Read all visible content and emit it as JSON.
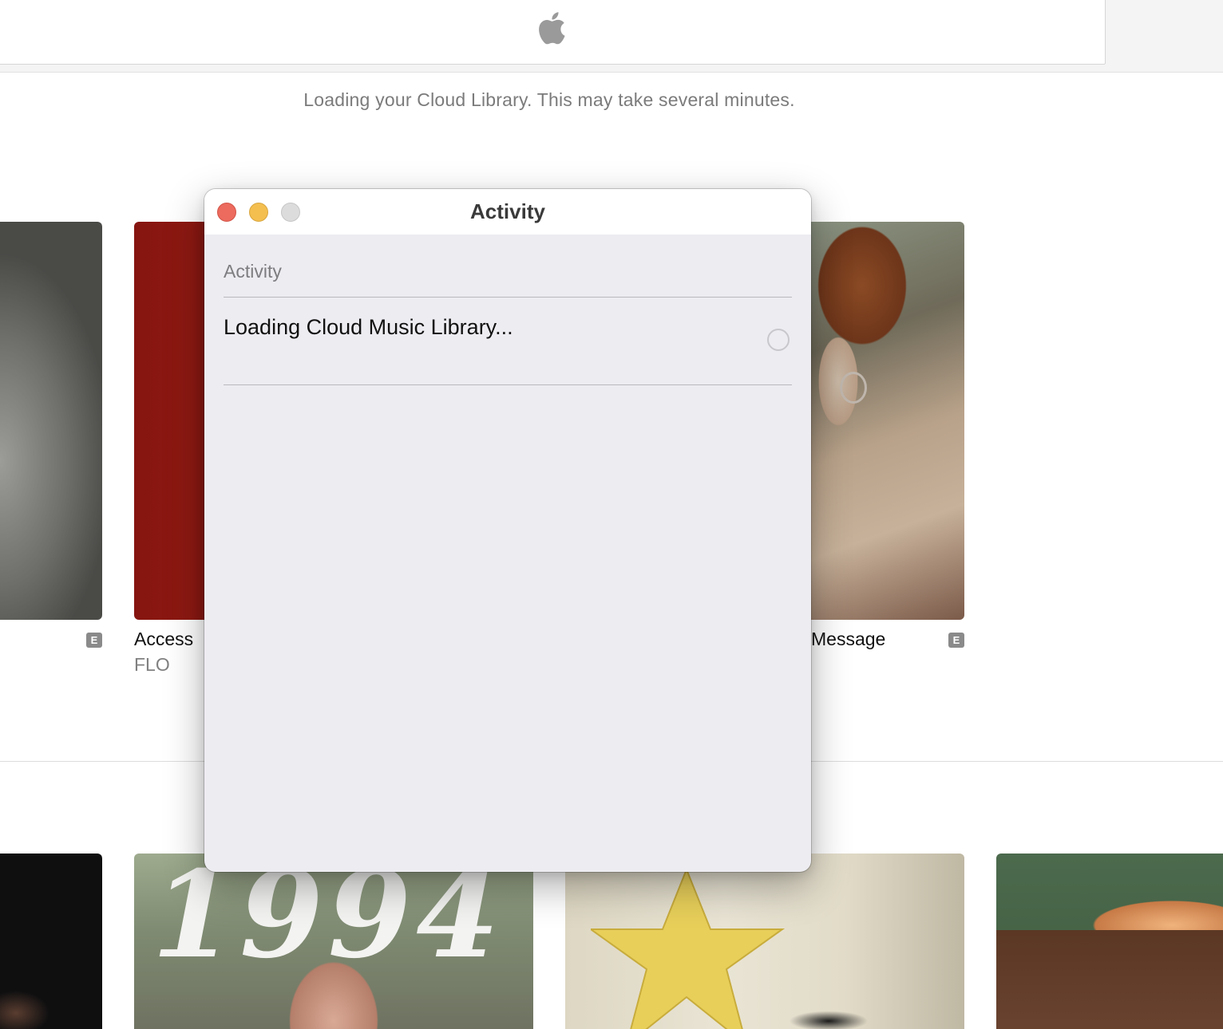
{
  "toolbar": {
    "logo_icon": "apple-logo-icon"
  },
  "banner": {
    "text": "Loading your Cloud Library. This may take several minutes."
  },
  "albums": [
    {
      "title": "Access",
      "artist": "FLO",
      "explicit": "E"
    },
    {
      "title": "Message",
      "explicit": "E"
    },
    {
      "explicit": "E"
    }
  ],
  "artwork": {
    "art5_text": "1994"
  },
  "activity_window": {
    "title": "Activity",
    "section_header": "Activity",
    "tasks": [
      {
        "label": "Loading Cloud Music Library..."
      }
    ],
    "colors": {
      "close": "#ec6a5e",
      "minimize": "#f4bf4f",
      "zoom": "#dcdcdc"
    }
  }
}
